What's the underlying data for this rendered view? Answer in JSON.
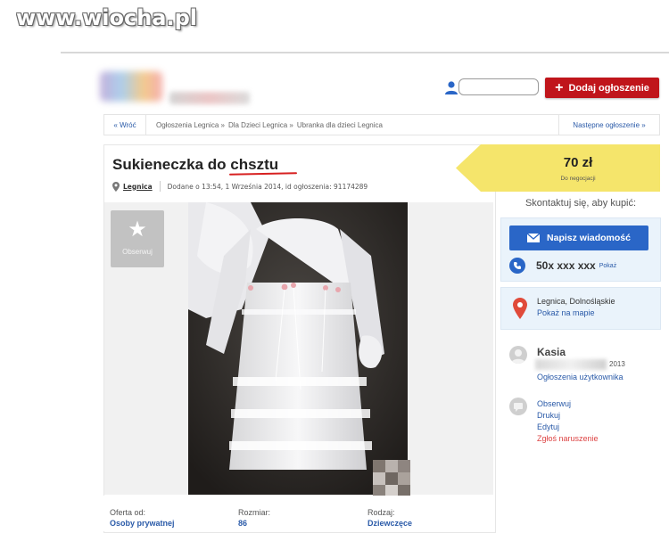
{
  "watermark": "www.wiocha.pl",
  "header": {
    "add_button": "Dodaj ogłoszenie"
  },
  "breadcrumb": {
    "back": "« Wróć",
    "items": [
      "Ogłoszenia Legnica »",
      "Dla Dzieci Legnica »",
      "Ubranka dla dzieci Legnica"
    ],
    "next": "Następne ogłoszenie »"
  },
  "listing": {
    "title_main": "Sukieneczka do ",
    "title_word": "chsztu",
    "location": "Legnica",
    "added": "Dodane o 13:54, 1 Września 2014, id ogłoszenia: 91174289",
    "observe": "Obserwuj",
    "details": [
      {
        "label": "Oferta od:",
        "value": "Osoby prywatnej"
      },
      {
        "label": "Rozmiar:",
        "value": "86"
      },
      {
        "label": "Rodzaj:",
        "value": "Dziewczęce"
      }
    ]
  },
  "price": {
    "value": "70 zł",
    "note": "Do negocjacji"
  },
  "contact": {
    "heading": "Skontaktuj się, aby kupić:",
    "message_button": "Napisz wiadomość",
    "phone": "50x xxx xxx",
    "show_phone": "Pokaż"
  },
  "location_box": {
    "place": "Legnica, Dolnośląskie",
    "map_link": "Pokaż na mapie"
  },
  "seller": {
    "name": "Kasia",
    "year_suffix": "2013",
    "listings_link": "Ogłoszenia użytkownika"
  },
  "actions": [
    "Obserwuj",
    "Drukuj",
    "Edytuj",
    "Zgłoś naruszenie"
  ],
  "colors": {
    "brand_red": "#c0151b",
    "accent_blue": "#2a66c7",
    "price_yellow": "#f5e56b",
    "contact_bg": "#eaf3fb"
  }
}
